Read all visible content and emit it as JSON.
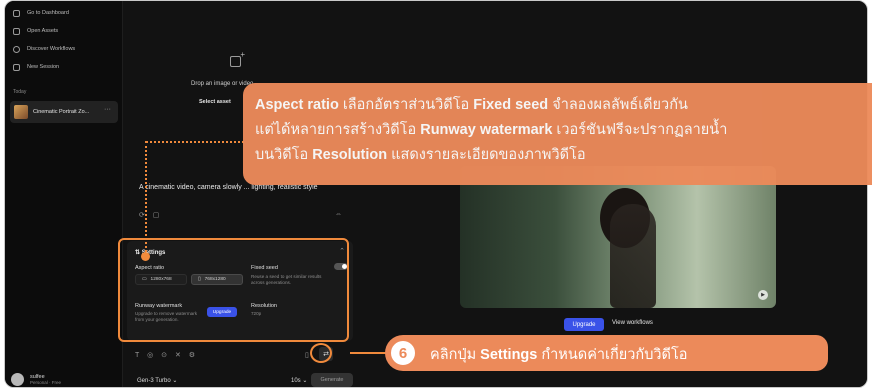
{
  "sidebar": {
    "nav": [
      {
        "label": "Go to Dashboard",
        "icon": "dashboard-icon"
      },
      {
        "label": "Open Assets",
        "icon": "folder-icon"
      },
      {
        "label": "Discover Workflows",
        "icon": "workflows-icon"
      },
      {
        "label": "New Session",
        "icon": "new-session-icon"
      }
    ],
    "section_label": "Today",
    "session_name": "Cinematic Portrait Zo...",
    "session_menu": "···",
    "user": {
      "name": "sulfee",
      "plan": "Personal · Free"
    }
  },
  "composer": {
    "drop_text": "Drop an image or video",
    "select_asset": "Select asset",
    "prompt": "A cinematic video, camera slowly ... lighting, realistic style",
    "settings": {
      "title": "Settings",
      "aspect_ratio_label": "Aspect ratio",
      "ratio_options": [
        "1280x768",
        "768x1280"
      ],
      "fixed_seed_label": "Fixed seed",
      "fixed_seed_desc": "Reuse a seed to get similar results across generations.",
      "watermark_label": "Runway watermark",
      "watermark_desc": "Upgrade to remove watermark from your generation.",
      "upgrade_label": "Upgrade",
      "resolution_label": "Resolution",
      "resolution_value": "720p"
    },
    "model": "Gen-3 Turbo",
    "duration": "10s",
    "generate_label": "Generate"
  },
  "preview": {
    "upgrade_label": "Upgrade",
    "view_workflows": "View workflows"
  },
  "annotation": {
    "callout_parts": [
      {
        "bold": "Aspect ratio",
        "text": " เลือกอัตราส่วนวิดีโอ "
      },
      {
        "bold": "Fixed seed",
        "text": " จำลองผลลัพธ์เดียวกัน"
      },
      {
        "bold": "",
        "text": "แต่ได้หลายการสร้างวิดีโอ "
      },
      {
        "bold": "Runway watermark",
        "text": " เวอร์ชันฟรีจะปรากฏลายน้ำ"
      },
      {
        "bold": "",
        "text": "บนวิดีโอ "
      },
      {
        "bold": "Resolution",
        "text": " แสดงรายละเอียดของภาพวิดีโอ"
      }
    ],
    "step_number": "6",
    "step_prefix": "คลิกปุ่ม ",
    "step_bold": "Settings",
    "step_suffix": " กำหนดค่าเกี่ยวกับวิดีโอ",
    "accent_color": "#ec8a5a"
  }
}
